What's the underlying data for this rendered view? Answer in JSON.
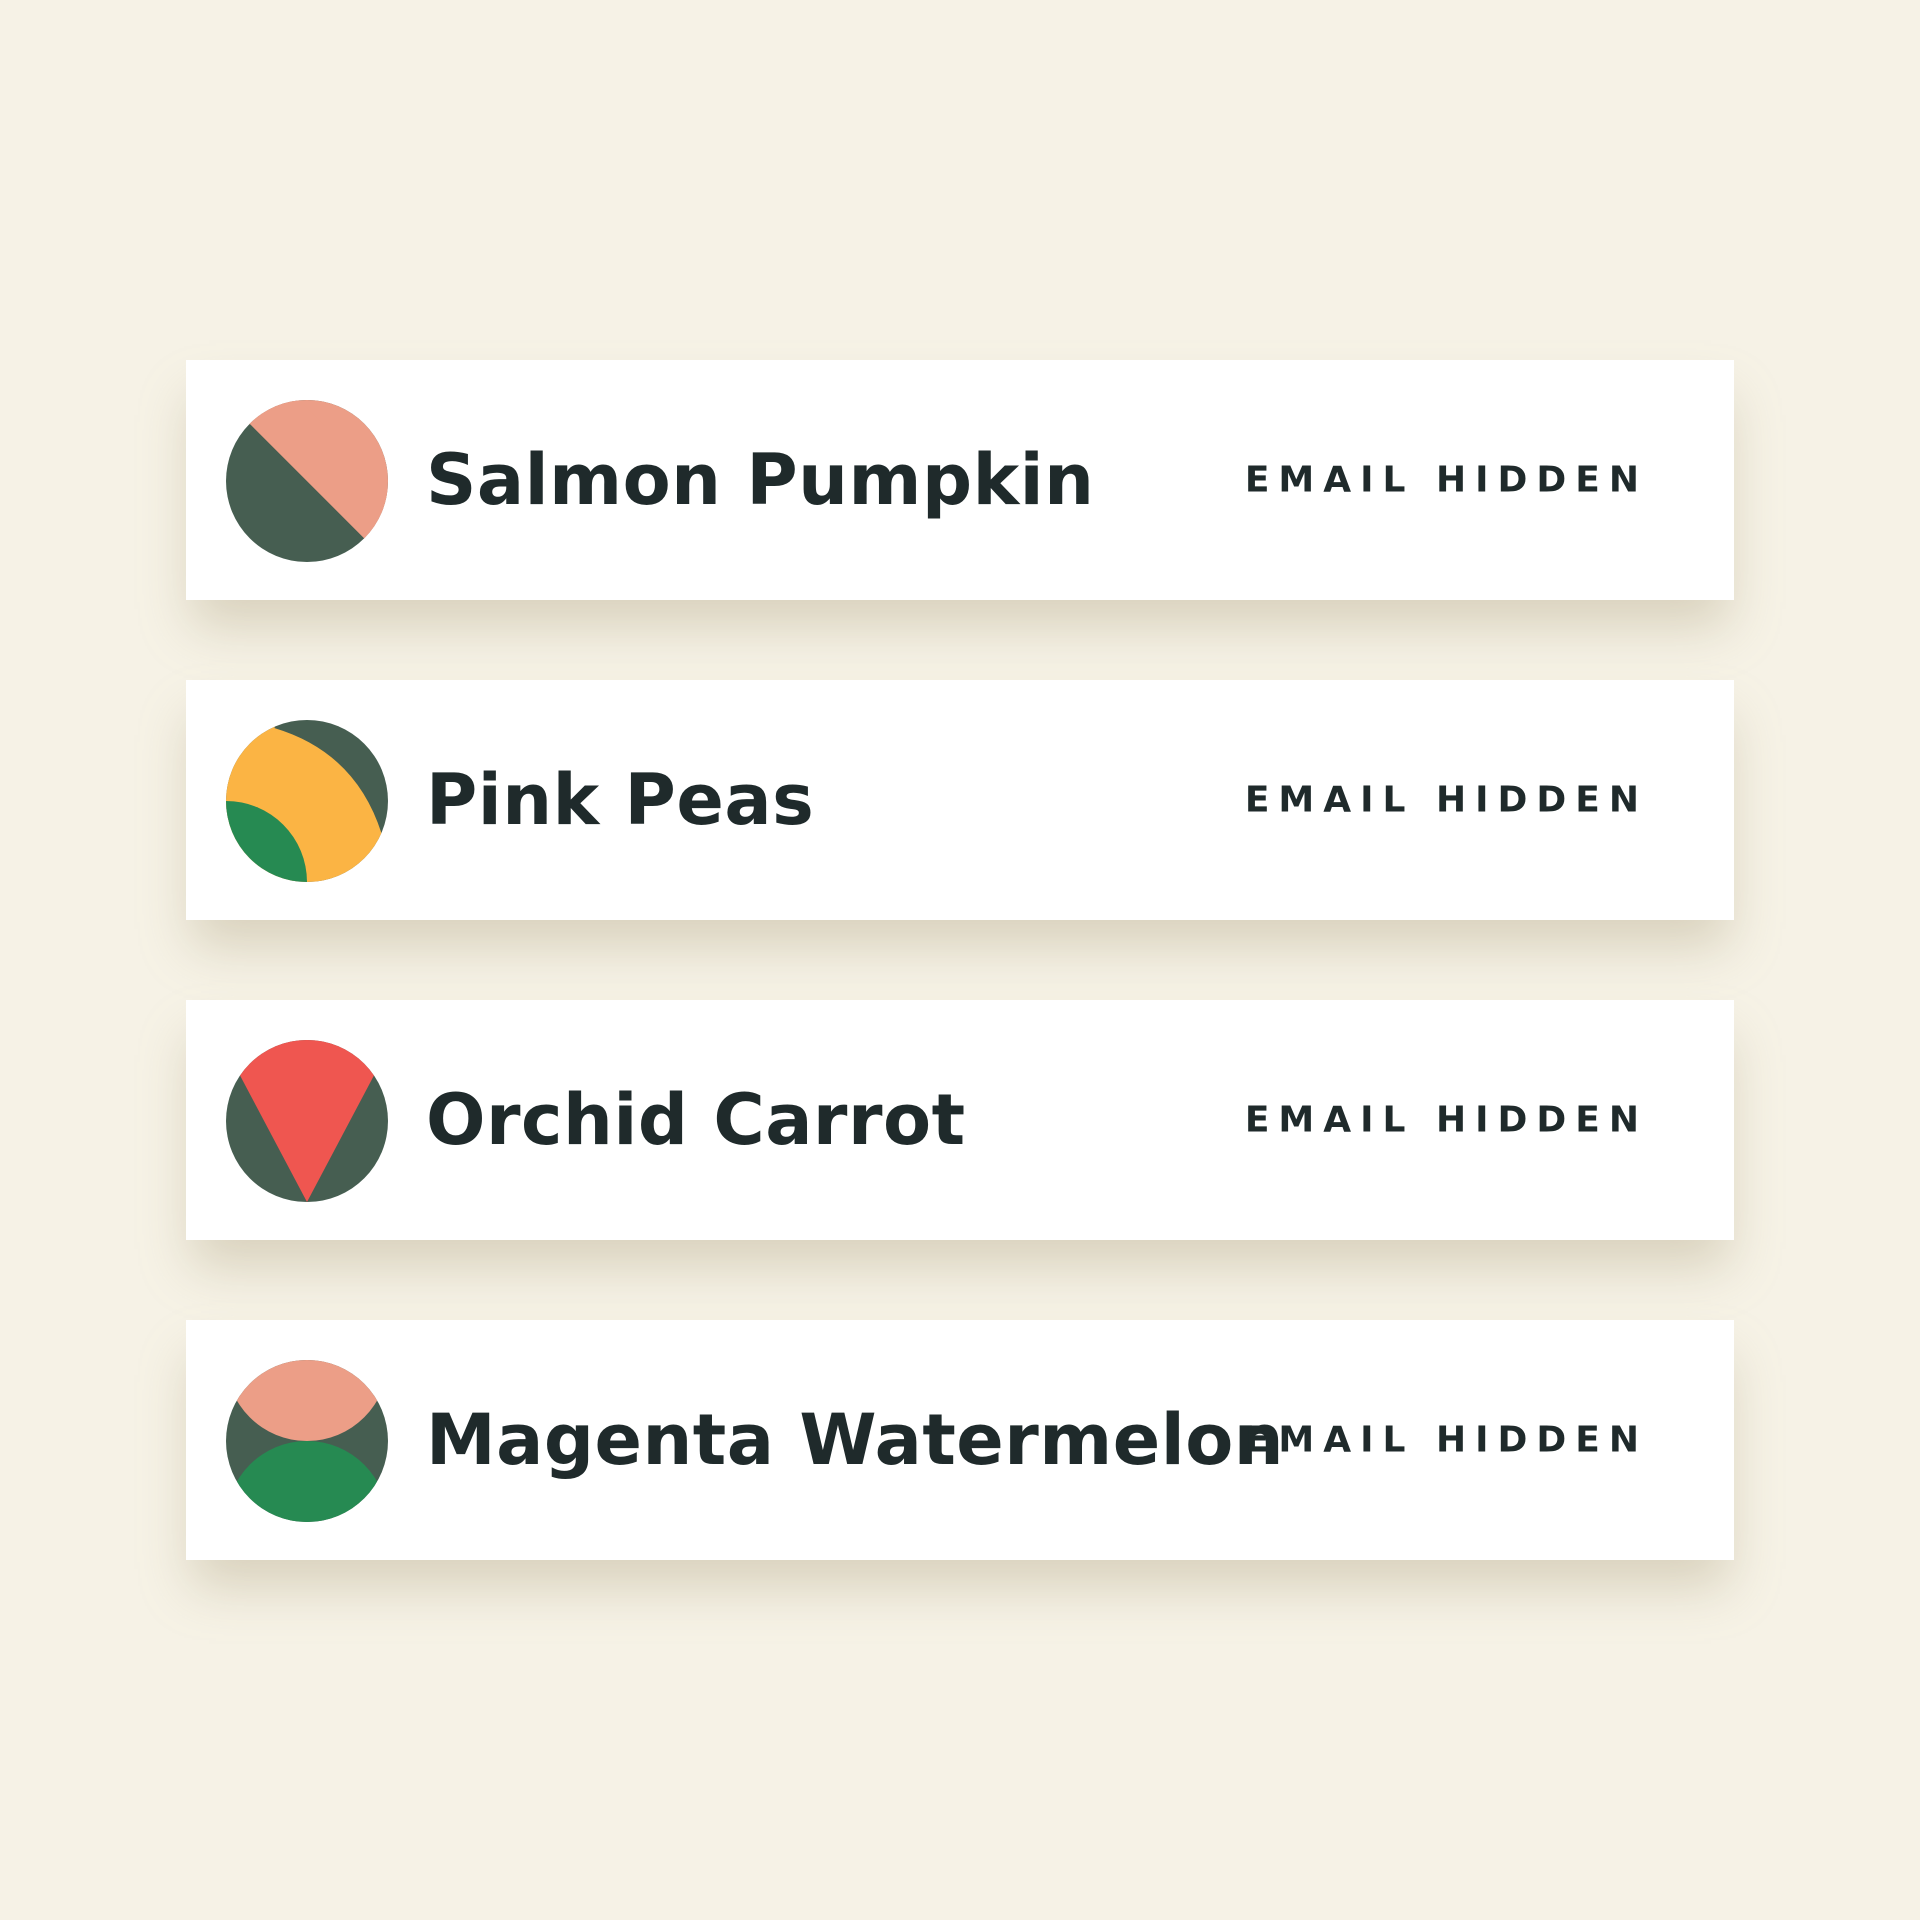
{
  "colors": {
    "background": "#f6f2e6",
    "card": "#ffffff",
    "text": "#1f2a2b",
    "slate": "#465e51",
    "salmon": "#ec9e87",
    "yellow": "#fbb444",
    "green": "#268a52",
    "red": "#ef5650"
  },
  "users": [
    {
      "name": "Salmon Pumpkin",
      "email": "EMAIL HIDDEN",
      "avatar_icon": "salmon-pumpkin-avatar-icon"
    },
    {
      "name": "Pink Peas",
      "email": "EMAIL HIDDEN",
      "avatar_icon": "pink-peas-avatar-icon"
    },
    {
      "name": "Orchid Carrot",
      "email": "EMAIL HIDDEN",
      "avatar_icon": "orchid-carrot-avatar-icon"
    },
    {
      "name": "Magenta Watermelon",
      "email": "EMAIL HIDDEN",
      "avatar_icon": "magenta-watermelon-avatar-icon"
    }
  ]
}
